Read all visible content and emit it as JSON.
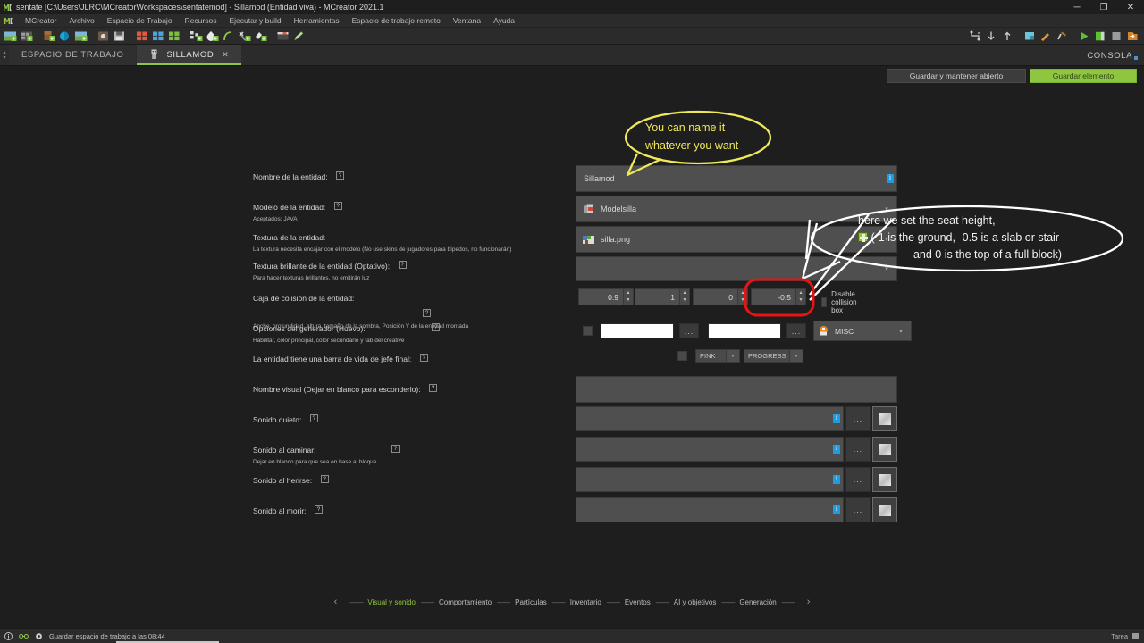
{
  "window": {
    "title": "sentate [C:\\Users\\JLRC\\MCreatorWorkspaces\\sentatemod] - Sillamod (Entidad viva) - MCreator 2021.1",
    "minimize": "─",
    "maximize": "❐",
    "close": "✕"
  },
  "menu": {
    "items": [
      {
        "label": "MCreator"
      },
      {
        "label": "Archivo"
      },
      {
        "label": "Espacio de Trabajo"
      },
      {
        "label": "Recursos"
      },
      {
        "label": "Ejecutar y build"
      },
      {
        "label": "Herramientas"
      },
      {
        "label": "Espacio de trabajo remoto"
      },
      {
        "label": "Ventana"
      },
      {
        "label": "Ayuda"
      }
    ]
  },
  "toolbar": {
    "left_icons": [
      "new-workspace-icon",
      "open-workspace-icon",
      "new-mod-element-icon",
      "import-texture-icon",
      "texture-maker-icon",
      "recipe-icon",
      "save-icon",
      "blocks-grid-red-icon",
      "blocks-grid-blue-icon",
      "blocks-grid-green-icon",
      "structure-icon",
      "particle-icon",
      "curve-icon",
      "tool-icon",
      "paint-icon",
      "resource-pack-icon",
      "pencil-icon"
    ],
    "right_icons": [
      "layout-icon",
      "download-icon",
      "upload-icon",
      "preferences-icon",
      "gradle-icon",
      "hammer-icon",
      "run-client-icon",
      "run-server-icon",
      "stop-icon",
      "export-icon"
    ]
  },
  "tabs": {
    "scroll_up": "▴",
    "scroll_down": "▾",
    "items": [
      {
        "label": "ESPACIO DE TRABAJO",
        "active": false,
        "closable": false
      },
      {
        "label": "SILLAMOD",
        "active": true,
        "closable": true,
        "close": "✕"
      }
    ],
    "console_label": "CONSOLA"
  },
  "actions": {
    "keep_open_label": "Guardar y mantener abierto",
    "save_label": "Guardar elemento"
  },
  "form": {
    "rows": [
      {
        "label": "Nombre de la entidad:",
        "sub": "",
        "help": "?",
        "value": "Sillamod"
      },
      {
        "label": "Modelo de la entidad:",
        "sub": "Aceptados: JAVA",
        "help": "?",
        "value": "Modelsilla"
      },
      {
        "label": "Textura de la entidad:",
        "sub": "La textura necesita encajar con el modelo (No use skins de jugadores para bípedos, no funcionarán)",
        "help": "",
        "value": "silla.png"
      },
      {
        "label": "Textura brillante de la entidad (Optativo):",
        "sub": "Para hacer texturas brillantes, no emitirán luz",
        "help": "?",
        "value": ""
      },
      {
        "label": "Caja de colisión de la entidad:",
        "sub": "Ancho, profundidad, altura, tamaño de la sombra, Posición Y de la entidad montada",
        "help": "?",
        "value": ""
      },
      {
        "label": "Opciones del generador (Huevo):",
        "sub": "Habilitar, color principal, color secundario y tab del creative",
        "help": "?",
        "value": ""
      },
      {
        "label": "La entidad tiene una barra de vida de jefe final:",
        "sub": "",
        "help": "?",
        "value": ""
      },
      {
        "label": "Nombre visual (Dejar en blanco para esconderlo):",
        "sub": "",
        "help": "?",
        "value": ""
      },
      {
        "label": "Sonido quieto:",
        "sub": "",
        "help": "?",
        "value": ""
      },
      {
        "label": "Sonido al caminar:",
        "sub": "Dejar en blanco para que sea en base al bloque",
        "help": "?",
        "value": ""
      },
      {
        "label": "Sonido al herirse:",
        "sub": "",
        "help": "?",
        "value": ""
      },
      {
        "label": "Sonido al morir:",
        "sub": "",
        "help": "?",
        "value": ""
      }
    ],
    "collision": {
      "width": "0.9",
      "depth": "1",
      "height": "0",
      "mounted_y": "-0.5",
      "disable_label": "Disable collision box",
      "shadow_placeholder": ""
    },
    "spawn_egg": {
      "primary_color": "",
      "secondary_color": "",
      "browse_label": "...",
      "tab_label": "MISC"
    },
    "boss_bar": {
      "color": "PINK",
      "type": "PROGRESS",
      "arrow": "▾"
    },
    "sound_browse_label": "...",
    "combo_arrow": "▾"
  },
  "bottom_nav": {
    "prev": "‹",
    "next": "›",
    "dash": "——",
    "items": [
      {
        "label": "Visual y sonido",
        "active": true
      },
      {
        "label": "Comportamiento",
        "active": false
      },
      {
        "label": "Partículas",
        "active": false
      },
      {
        "label": "Inventario",
        "active": false
      },
      {
        "label": "Eventos",
        "active": false
      },
      {
        "label": "AI y objetivos",
        "active": false
      },
      {
        "label": "Generación",
        "active": false
      }
    ]
  },
  "statusbar": {
    "icons": [
      "info-icon",
      "link-icon",
      "gear-icon"
    ],
    "message": "Guardar espacio de trabajo a las 08:44",
    "task_label": "Tarea"
  },
  "annotations": {
    "name_callout": {
      "line1": "You can name it",
      "line2": "whatever you want",
      "color": "#efe85a"
    },
    "height_callout": {
      "line1": "here we set the seat height,",
      "line2_prefix": "(-1 is the ground, -0.5 is a slab or stair",
      "line3": "and 0 is the top of a full block)",
      "color": "#ffffff"
    },
    "highlight_box": {
      "color": "#e81313"
    }
  }
}
